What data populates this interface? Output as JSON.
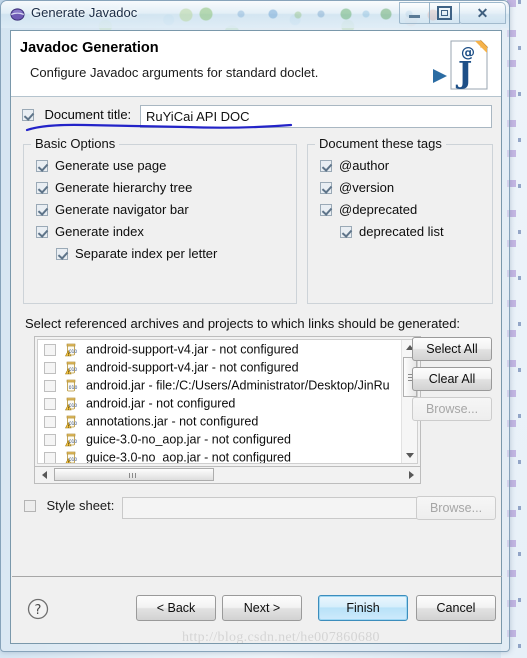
{
  "window": {
    "title": "Generate Javadoc",
    "icon": "eclipse-globe-icon",
    "buttons": {
      "minimize": "minimize-icon",
      "restore": "restore-icon",
      "close": "close-icon"
    }
  },
  "wizard": {
    "title": "Javadoc Generation",
    "subtitle": "Configure Javadoc arguments for standard doclet.",
    "banner_icon": "javadoc-document-icon"
  },
  "doc_title": {
    "checkbox_label": "Document title:",
    "checked": true,
    "value": "RuYiCai API DOC",
    "placeholder": ""
  },
  "basic_options": {
    "legend": "Basic Options",
    "items": [
      {
        "label": "Generate use page",
        "checked": true,
        "indent": false
      },
      {
        "label": "Generate hierarchy tree",
        "checked": true,
        "indent": false
      },
      {
        "label": "Generate navigator bar",
        "checked": true,
        "indent": false
      },
      {
        "label": "Generate index",
        "checked": true,
        "indent": false
      },
      {
        "label": "Separate index per letter",
        "checked": true,
        "indent": true
      }
    ]
  },
  "document_tags": {
    "legend": "Document these tags",
    "items": [
      {
        "label": "@author",
        "checked": true,
        "indent": false
      },
      {
        "label": "@version",
        "checked": true,
        "indent": false
      },
      {
        "label": "@deprecated",
        "checked": true,
        "indent": false
      },
      {
        "label": "deprecated list",
        "checked": true,
        "indent": true
      }
    ]
  },
  "archives": {
    "label": "Select referenced archives and projects to which links should be generated:",
    "rows": [
      {
        "text": "android-support-v4.jar - not configured",
        "checked": false,
        "icon": "jar-warning-icon"
      },
      {
        "text": "android-support-v4.jar - not configured",
        "checked": false,
        "icon": "jar-warning-icon"
      },
      {
        "text": "android.jar - file:/C:/Users/Administrator/Desktop/JinRu",
        "checked": false,
        "icon": "jar-icon"
      },
      {
        "text": "android.jar - not configured",
        "checked": false,
        "icon": "jar-warning-icon"
      },
      {
        "text": "annotations.jar - not configured",
        "checked": false,
        "icon": "jar-warning-icon"
      },
      {
        "text": "guice-3.0-no_aop.jar - not configured",
        "checked": false,
        "icon": "jar-warning-icon"
      },
      {
        "text": "guice-3.0-no_aop.jar - not configured",
        "checked": false,
        "icon": "jar-warning-icon"
      }
    ],
    "select_all": "Select All",
    "clear_all": "Clear All",
    "browse": "Browse..."
  },
  "style_sheet": {
    "checkbox_label": "Style sheet:",
    "checked": false,
    "value": "",
    "browse": "Browse..."
  },
  "footer": {
    "help_icon": "help-question-icon",
    "back": "< Back",
    "next": "Next >",
    "finish": "Finish",
    "cancel": "Cancel",
    "watermark": "http://blog.csdn.net/he007860680"
  },
  "colors": {
    "accent": "#3c8dbc",
    "dialog_bg": "#f0f0f0",
    "header_bg": "#ffffff",
    "scribble": "#2323c8"
  }
}
